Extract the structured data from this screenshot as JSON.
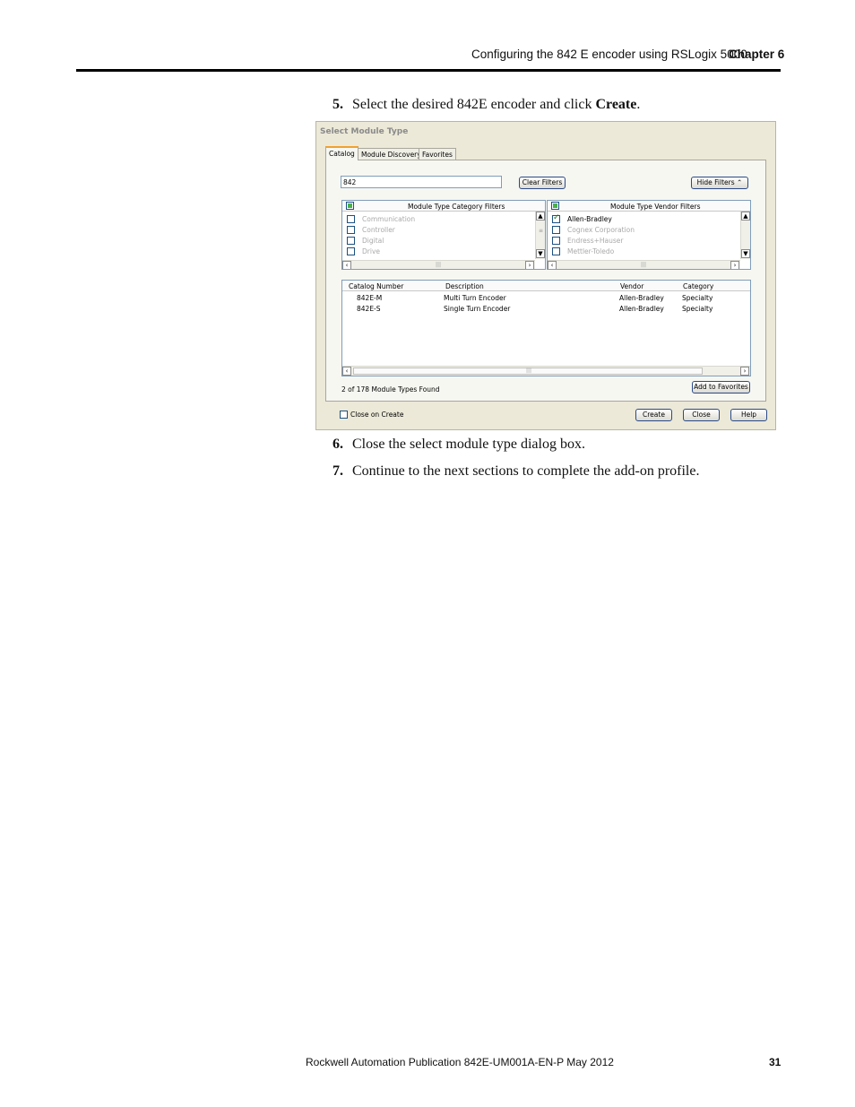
{
  "header": {
    "title": "Configuring the 842 E encoder using RSLogix 5000",
    "chapter": "Chapter 6"
  },
  "steps": [
    {
      "num": "5.",
      "text": "Select the desired 842E encoder and click ",
      "bold": "Create",
      "after": "."
    },
    {
      "num": "6.",
      "text": "Close the select module type dialog box."
    },
    {
      "num": "7.",
      "text": "Continue to the next sections to complete the add-on profile."
    }
  ],
  "dialog": {
    "title": "Select Module Type",
    "tabs": [
      "Catalog",
      "Module Discovery",
      "Favorites"
    ],
    "search_value": "842",
    "clear_filters": "Clear Filters",
    "hide_filters": "Hide Filters",
    "category_filters": {
      "header": "Module Type Category Filters",
      "items": [
        "Communication",
        "Controller",
        "Digital",
        "Drive"
      ]
    },
    "vendor_filters": {
      "header": "Module Type Vendor Filters",
      "items": [
        "Allen-Bradley",
        "Cognex Corporation",
        "Endress+Hauser",
        "Mettler-Toledo"
      ]
    },
    "columns": [
      "Catalog Number",
      "Description",
      "Vendor",
      "Category"
    ],
    "rows": [
      [
        "842E-M",
        "Multi Turn Encoder",
        "Allen-Bradley",
        "Specialty"
      ],
      [
        "842E-S",
        "Single Turn Encoder",
        "Allen-Bradley",
        "Specialty"
      ]
    ],
    "status": "2  of 178 Module Types Found",
    "add_to_favorites": "Add to Favorites",
    "close_on_create": "Close on Create",
    "create": "Create",
    "close": "Close",
    "help": "Help"
  },
  "footer": {
    "publication": "Rockwell Automation Publication 842E-UM001A-EN-P May 2012",
    "page": "31"
  }
}
